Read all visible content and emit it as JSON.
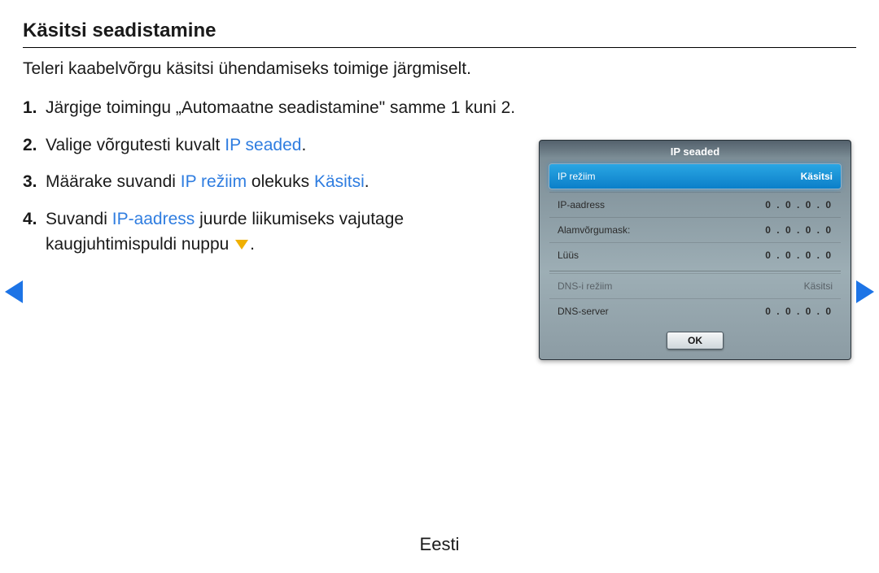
{
  "title": "Käsitsi seadistamine",
  "intro": "Teleri kaabelvõrgu käsitsi ühendamiseks toimige järgmiselt.",
  "steps": {
    "s1": {
      "num": "1.",
      "text": "Järgige toimingu „Automaatne seadistamine\" samme 1 kuni 2."
    },
    "s2": {
      "num": "2.",
      "pre": "Valige võrgutesti kuvalt ",
      "hl": "IP seaded",
      "post": "."
    },
    "s3": {
      "num": "3.",
      "pre": "Määrake suvandi ",
      "hl1": "IP režiim",
      "mid": " olekuks ",
      "hl2": "Käsitsi",
      "post": "."
    },
    "s4": {
      "num": "4.",
      "pre": "Suvandi ",
      "hl": "IP-aadress",
      "mid": " juurde liikumiseks vajutage kaugjuhtimispuldi nuppu ",
      "post": "."
    }
  },
  "panel": {
    "title": "IP seaded",
    "rows": {
      "mode": {
        "label": "IP režiim",
        "value": "Käsitsi"
      },
      "ip": {
        "label": "IP-aadress",
        "value": "0 . 0 . 0 . 0"
      },
      "mask": {
        "label": "Alamvõrgumask:",
        "value": "0 . 0 . 0 . 0"
      },
      "gw": {
        "label": "Lüüs",
        "value": "0 . 0 . 0 . 0"
      },
      "dnsm": {
        "label": "DNS-i režiim",
        "value": "Käsitsi"
      },
      "dns": {
        "label": "DNS-server",
        "value": "0 . 0 . 0 . 0"
      }
    },
    "ok": "OK"
  },
  "footer": "Eesti"
}
